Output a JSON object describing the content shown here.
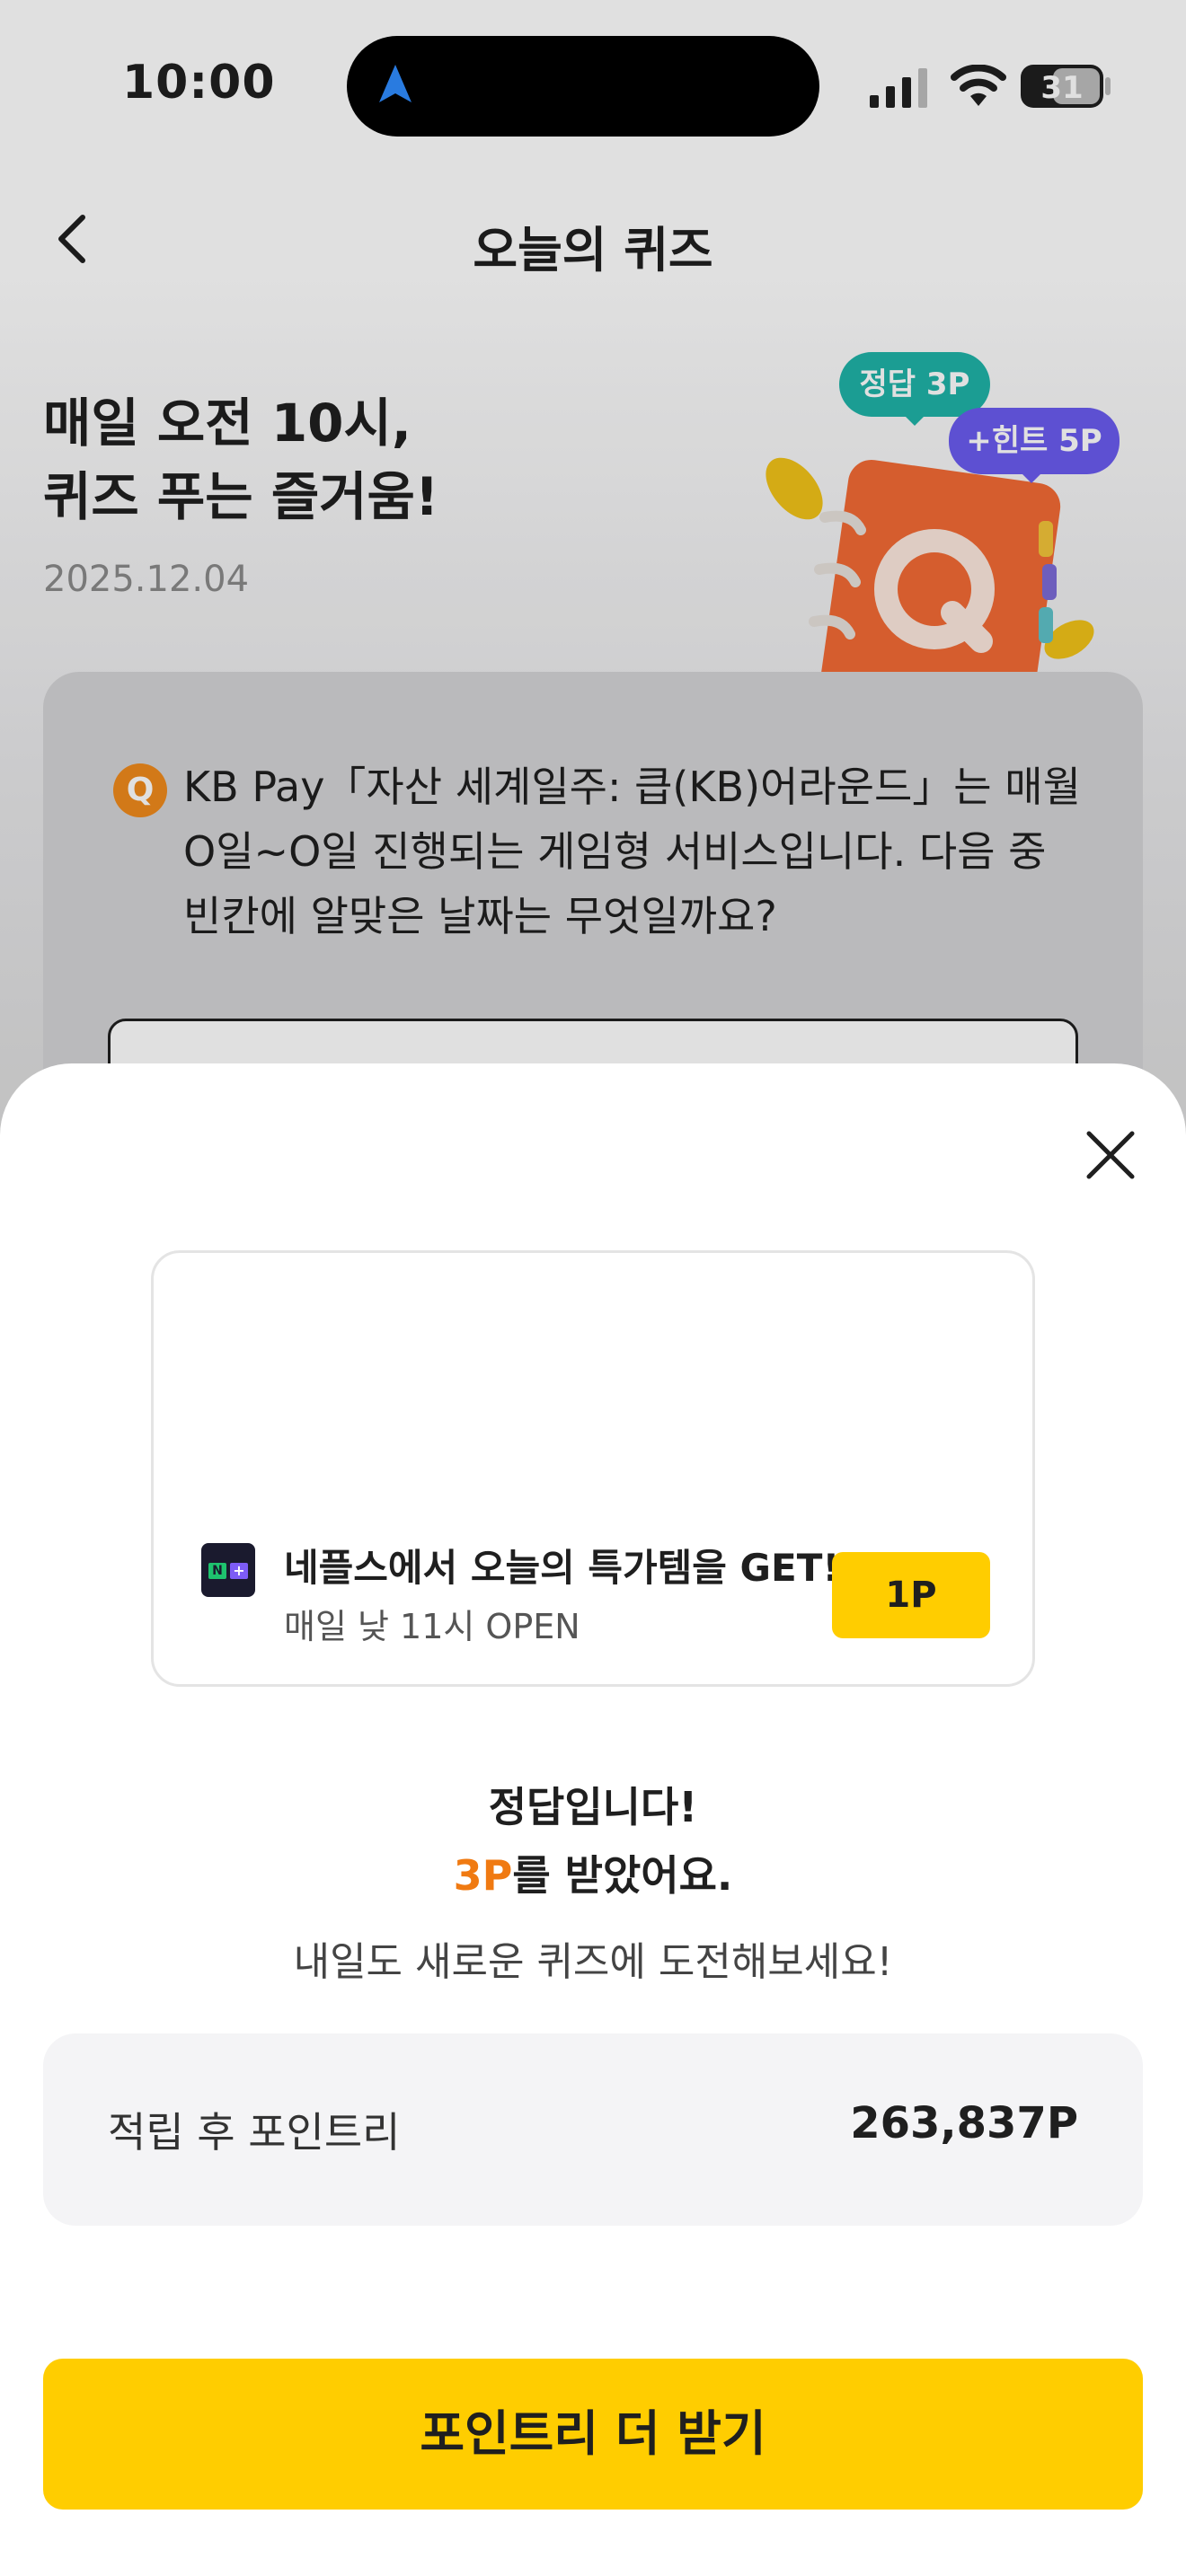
{
  "status_bar": {
    "time": "10:00",
    "battery": "31"
  },
  "header": {
    "title": "오늘의 퀴즈",
    "back_icon": "chevron-left-icon"
  },
  "hero": {
    "title_line1": "매일 오전 10시,",
    "title_line2": "퀴즈 푸는 즐거움!",
    "date": "2025.12.04",
    "badge_answer": "정답 3P",
    "badge_hint": "+힌트 5P"
  },
  "quiz": {
    "badge": "Q",
    "question": "KB Pay「자산 세계일주: 큽(KB)어라운드」는 매월 O일~O일 진행되는 게임형 서비스입니다. 다음 중 빈칸에 알맞은 날짜는 무엇일까요?"
  },
  "sheet": {
    "close_icon": "close-icon",
    "ad": {
      "logo_n": "N",
      "logo_plus": "+",
      "title": "네플스에서 오늘의 특가템을 GET!",
      "subtitle": "매일 낮 11시 OPEN",
      "button": "1P"
    },
    "result_line1": "정답입니다!",
    "result_points": "3P",
    "result_line2_suffix": "를 받았어요.",
    "result_line3": "내일도 새로운 퀴즈에 도전해보세요!",
    "points_label": "적립 후 포인트리",
    "points_value": "263,837P",
    "cta": "포인트리 더 받기"
  },
  "colors": {
    "accent_yellow": "#ffcd00",
    "accent_orange": "#f07a12",
    "answer_badge": "#1fb3a8",
    "hint_badge": "#6a5cf0"
  }
}
